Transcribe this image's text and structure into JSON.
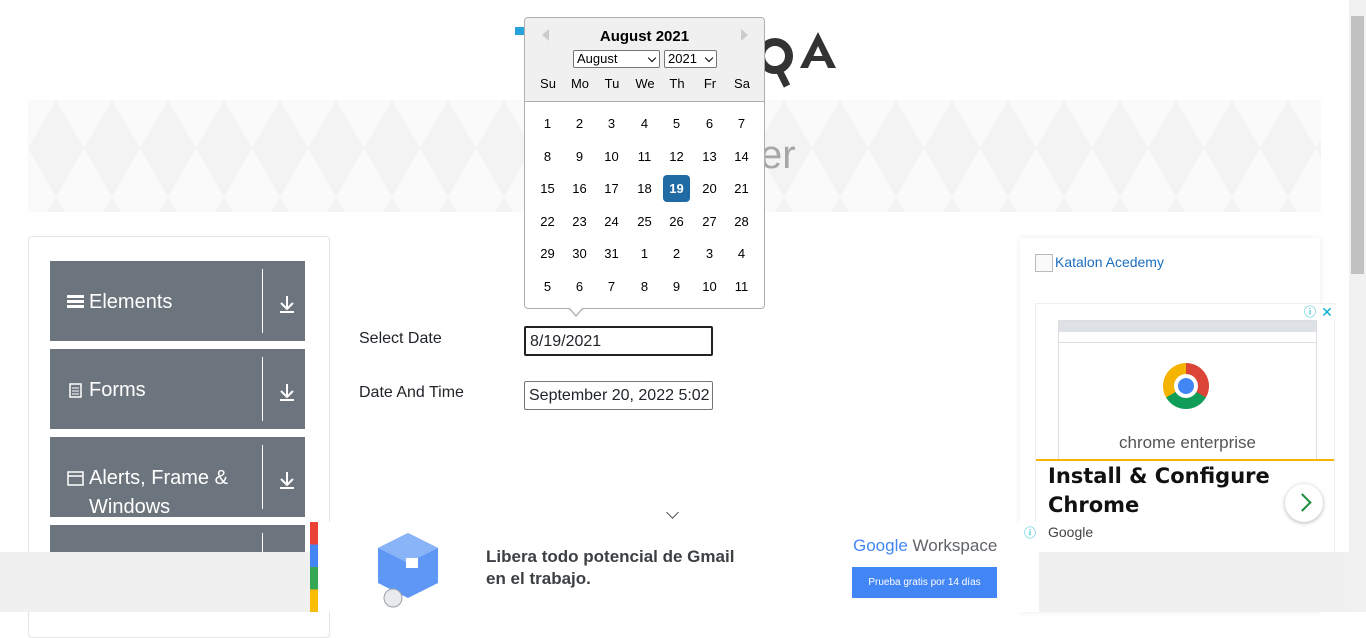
{
  "logo": {
    "text": "QA"
  },
  "banner": {
    "title": "er"
  },
  "sidebar": {
    "groups": [
      {
        "label": "Elements",
        "icon": "menu-icon"
      },
      {
        "label": "Forms",
        "icon": "document-icon"
      },
      {
        "label": "Alerts, Frame & Windows",
        "icon": "window-icon"
      },
      {
        "label": "",
        "icon": ""
      }
    ]
  },
  "form": {
    "select_date_label": "Select Date",
    "select_date_value": "8/19/2021",
    "date_time_label": "Date And Time",
    "date_time_value": "September 20, 2022 5:02"
  },
  "calendar": {
    "title": "August 2021",
    "month_selected": "August",
    "year_selected": "2021",
    "weekdays": [
      "Su",
      "Mo",
      "Tu",
      "We",
      "Th",
      "Fr",
      "Sa"
    ],
    "weeks": [
      [
        "1",
        "2",
        "3",
        "4",
        "5",
        "6",
        "7"
      ],
      [
        "8",
        "9",
        "10",
        "11",
        "12",
        "13",
        "14"
      ],
      [
        "15",
        "16",
        "17",
        "18",
        "19",
        "20",
        "21"
      ],
      [
        "22",
        "23",
        "24",
        "25",
        "26",
        "27",
        "28"
      ],
      [
        "29",
        "30",
        "31",
        "1",
        "2",
        "3",
        "4"
      ],
      [
        "5",
        "6",
        "7",
        "8",
        "9",
        "10",
        "11"
      ]
    ],
    "selected_day": "19"
  },
  "right_ad": {
    "image_alt": "Katalon Acedemy",
    "product": "chrome enterprise",
    "title": "Install & Configure Chrome",
    "source": "Google",
    "adchoices_icon": "ⓘ",
    "close_icon": "✕"
  },
  "bottom_ad": {
    "text": "Libera todo potencial de Gmail en el trabajo.",
    "brand_google": "Google",
    "brand_rest": " Workspace",
    "button": "Prueba gratis por 14 días",
    "info_icon": "ⓘ"
  },
  "colors": {
    "accent": "#216ba5",
    "sidebar_group": "#6c757d",
    "google_blue": "#4285f4"
  }
}
